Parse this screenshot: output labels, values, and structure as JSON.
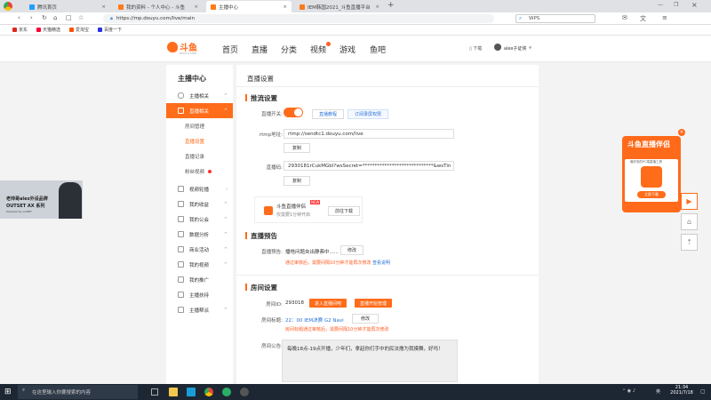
{
  "browser": {
    "tabs": [
      {
        "title": "腾讯首页",
        "color": "#1aa0ff"
      },
      {
        "title": "我的资料 - 个人中心 - 斗鱼",
        "color": "#ff7a1a"
      },
      {
        "title": "主播中心",
        "color": "#ff7a1a"
      },
      {
        "title": "IEM韩国2021_斗鱼直播平台",
        "color": "#ff7a1a"
      }
    ],
    "new_tab": "+",
    "url": "https://mp.douyu.com/live/main",
    "search_placeholder": "WPS",
    "bookmarks": [
      {
        "label": "京东",
        "color": "#e1251b"
      },
      {
        "label": "天猫精选",
        "color": "#ff0036"
      },
      {
        "label": "爱淘宝",
        "color": "#ff5000"
      },
      {
        "label": "百度一下",
        "color": "#2932e1"
      }
    ]
  },
  "site": {
    "logo_text": "斗鱼",
    "logo_sub": "DOUYU.COM",
    "nav": [
      "首页",
      "直播",
      "分类",
      "视频",
      "游戏",
      "鱼吧"
    ],
    "download": "下载",
    "user": "alex子证侠"
  },
  "sidebar": {
    "title": "主播中心",
    "items": [
      {
        "label": "主播相关",
        "arrow": "^"
      },
      {
        "label": "直播相关",
        "arrow": "^",
        "active": true
      },
      {
        "label": "视频轮播",
        "arrow": "›"
      },
      {
        "label": "我的收益",
        "arrow": "^"
      },
      {
        "label": "我的公会",
        "arrow": "^"
      },
      {
        "label": "数据分析",
        "arrow": "^"
      },
      {
        "label": "商业活动",
        "arrow": "^"
      },
      {
        "label": "我的视频",
        "arrow": "^"
      },
      {
        "label": "我的推广",
        "arrow": ""
      },
      {
        "label": "主播扶持",
        "arrow": ""
      },
      {
        "label": "主播帮派",
        "arrow": "^"
      }
    ],
    "subitems": [
      "房间管理",
      "直播设置",
      "直播记录",
      "粉丝视频"
    ]
  },
  "main": {
    "page_title": "直播设置",
    "stream": {
      "title": "推流设置",
      "switch_label": "直播开关:",
      "tutorial_btn": "直播教程",
      "record_btn": "订阅录屏权限",
      "rtmp_label": "rtmp地址:",
      "rtmp_value": "rtmp://sendtc1.douyu.com/live",
      "copy_btn": "复制",
      "code_label": "直播码:",
      "code_value": "2930181rCukMGbl?wsSecret=*****************************&wsTin",
      "copy_btn2": "复制",
      "companion_title": "斗鱼直播伴侣",
      "companion_sub": "仅需要1分钟开启",
      "companion_badge": "NEW",
      "companion_btn": "前往下载"
    },
    "notice": {
      "title": "直播预告",
      "label": "直播预告:",
      "value": "播啥问题央出静弗中......",
      "edit_btn": "修改",
      "warn": "通过审核后，需要间隔10分钟才能再次修改",
      "warn_link": "查看说明"
    },
    "room": {
      "title": "房间设置",
      "id_label": "房间ID:",
      "id_value": "293018",
      "entry_btn": "进入直播间吧",
      "manage_btn": "直播开始管理",
      "title_label": "房间标题:",
      "title_value": "22：00 IEM决赛 G2 Navi",
      "edit_btn": "修改",
      "title_warn": "房间标题通过审核后，需要间隔10分钟才能再次修改",
      "announce_label": "房间公告:",
      "announce_value": "每晚18点-19点开播，少年们，拿起你们手中的民法撸为我摸舞，好吗！"
    }
  },
  "promo": {
    "title": "斗鱼直播伴侣",
    "sub": "最好用的PC端直播工具",
    "btn": "立即下载",
    "close": "×"
  },
  "cam": {
    "line1": "老帅哥alex外设品牌",
    "line2": "OUTSET AX 系列",
    "line3": "Powered by outSET"
  },
  "taskbar": {
    "search": "在这里输入你要搜索的内容",
    "time": "21:34",
    "date": "2021/7/18",
    "ime": "英"
  }
}
